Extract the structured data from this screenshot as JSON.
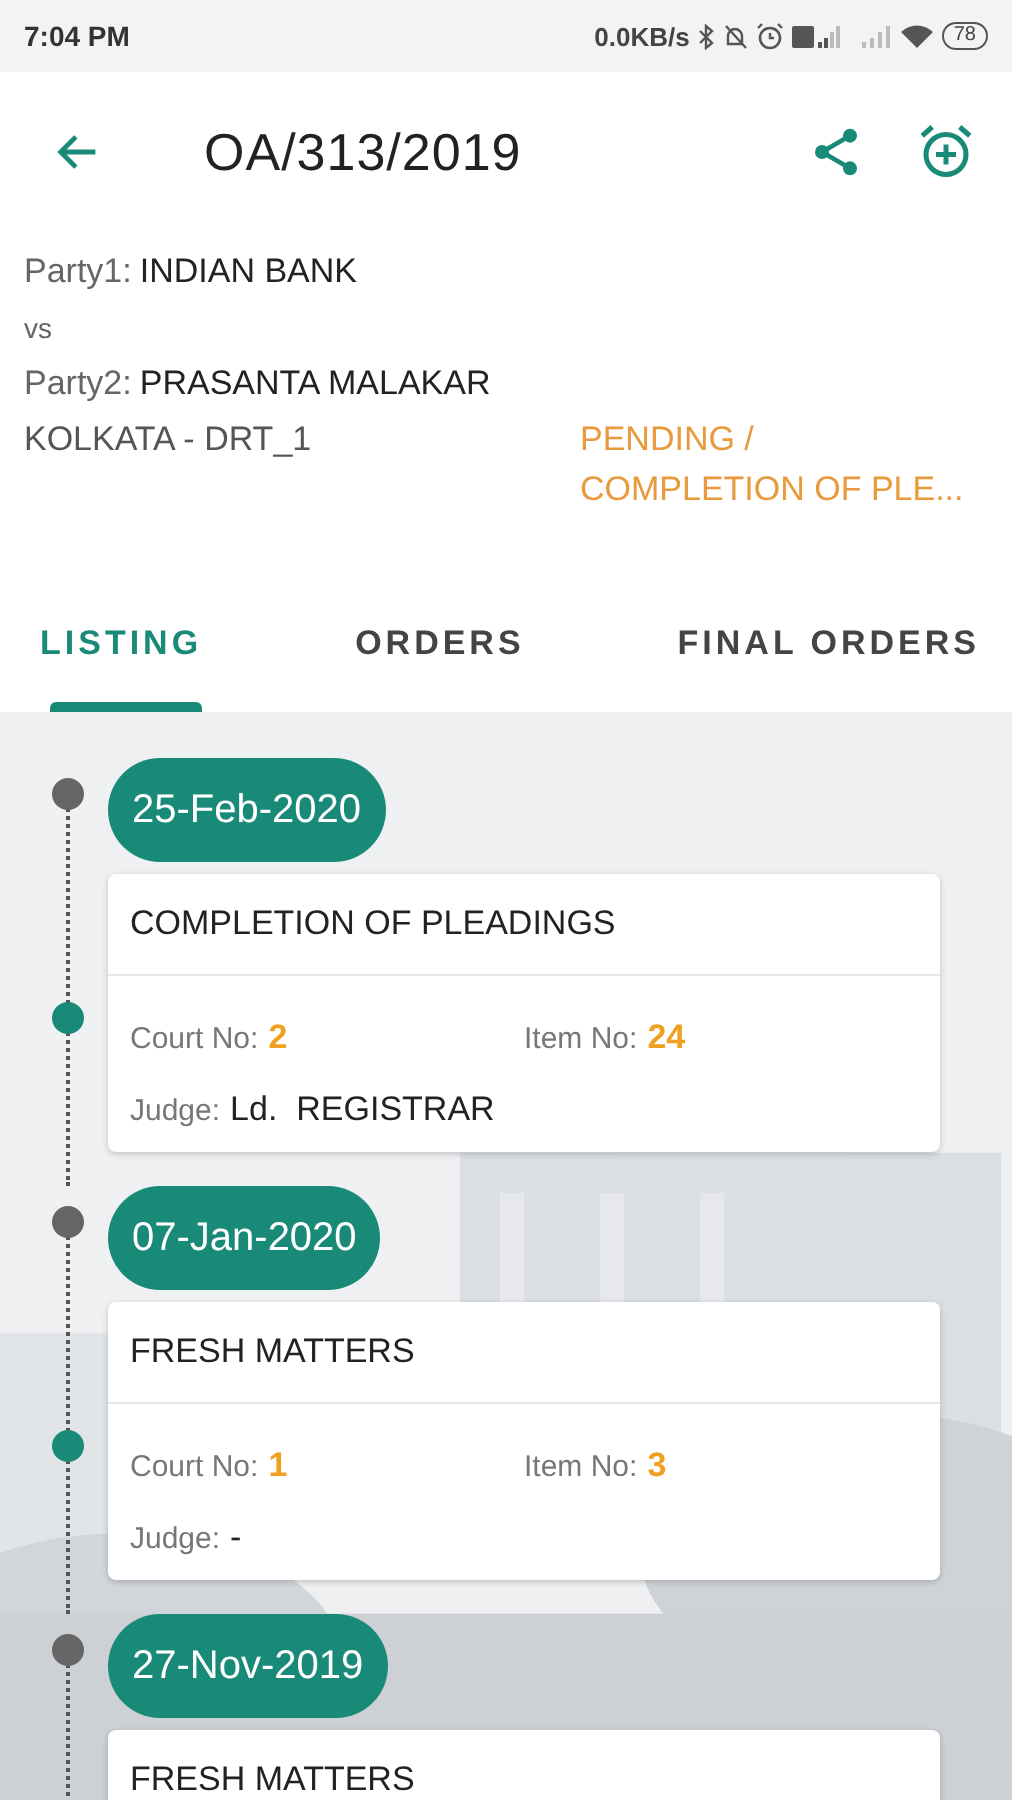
{
  "status_bar": {
    "time": "7:04 PM",
    "speed": "0.0KB/s",
    "battery": "78"
  },
  "app_bar": {
    "title": "OA/313/2019"
  },
  "case": {
    "party1_label": "Party1:",
    "party1": "INDIAN BANK",
    "vs": "vs",
    "party2_label": "Party2:",
    "party2": "PRASANTA MALAKAR",
    "bench": "KOLKATA - DRT_1",
    "status": "PENDING / COMPLETION OF PLE..."
  },
  "tabs": [
    {
      "label": "LISTING",
      "selected": true
    },
    {
      "label": "ORDERS",
      "selected": false
    },
    {
      "label": "FINAL ORDERS",
      "selected": false
    }
  ],
  "listings": [
    {
      "date": "25-Feb-2020",
      "title": "COMPLETION OF PLEADINGS",
      "court_label": "Court No:",
      "court_no": "2",
      "item_label": "Item No:",
      "item_no": "24",
      "judge_label": "Judge:",
      "judge": "Ld.  REGISTRAR"
    },
    {
      "date": "07-Jan-2020",
      "title": "FRESH MATTERS",
      "court_label": "Court No:",
      "court_no": "1",
      "item_label": "Item No:",
      "item_no": "3",
      "judge_label": "Judge:",
      "judge": "-"
    },
    {
      "date": "27-Nov-2019",
      "title": "FRESH MATTERS"
    }
  ]
}
